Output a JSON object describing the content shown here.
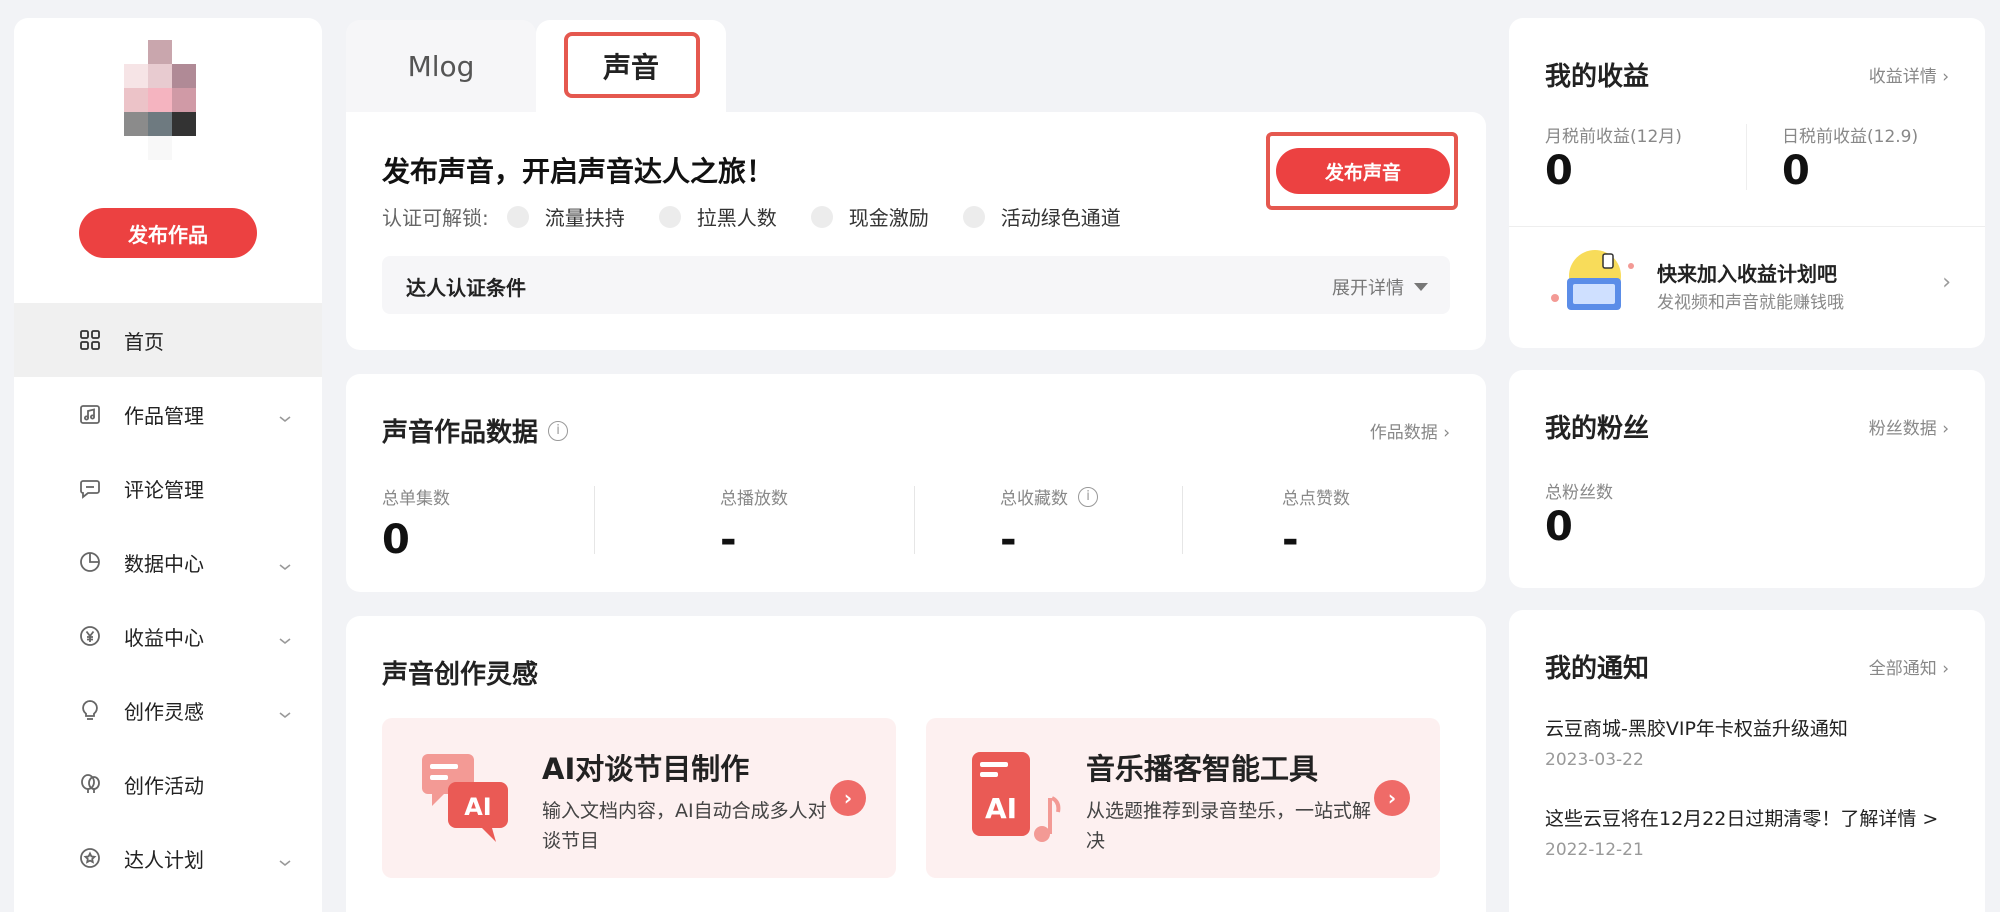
{
  "sidebar": {
    "publish_button": "发布作品",
    "items": [
      {
        "label": "首页",
        "icon": "grid-icon",
        "has_chevron": false,
        "active": true
      },
      {
        "label": "作品管理",
        "icon": "music-doc-icon",
        "has_chevron": true
      },
      {
        "label": "评论管理",
        "icon": "comment-icon",
        "has_chevron": false
      },
      {
        "label": "数据中心",
        "icon": "pie-chart-icon",
        "has_chevron": true
      },
      {
        "label": "收益中心",
        "icon": "yen-icon",
        "has_chevron": true
      },
      {
        "label": "创作灵感",
        "icon": "lightbulb-icon",
        "has_chevron": true
      },
      {
        "label": "创作活动",
        "icon": "balloon-icon",
        "has_chevron": false
      },
      {
        "label": "达人计划",
        "icon": "star-badge-icon",
        "has_chevron": true
      }
    ]
  },
  "tabs": [
    {
      "label": "Mlog"
    },
    {
      "label": "声音"
    }
  ],
  "publish": {
    "title": "发布声音，开启声音达人之旅！",
    "unlock_label": "认证可解锁:",
    "perks": [
      "流量扶持",
      "拉黑人数",
      "现金激励",
      "活动绿色通道"
    ],
    "publish_button": "发布声音",
    "conditions_label": "达人认证条件",
    "expand_label": "展开详情"
  },
  "stats": {
    "title": "声音作品数据",
    "link": "作品数据",
    "items": [
      {
        "label": "总单集数",
        "value": "0"
      },
      {
        "label": "总播放数",
        "value": "-"
      },
      {
        "label": "总收藏数",
        "value": "-"
      },
      {
        "label": "总点赞数",
        "value": "-"
      }
    ]
  },
  "inspiration": {
    "title": "声音创作灵感",
    "items": [
      {
        "title": "AI对谈节目制作",
        "desc": "输入文档内容，AI自动合成多人对谈节目",
        "art_label": "AI"
      },
      {
        "title": "音乐播客智能工具",
        "desc": "从选题推荐到录音垫乐，一站式解决",
        "art_label": "AI"
      }
    ]
  },
  "earnings": {
    "title": "我的收益",
    "link": "收益详情",
    "monthly_label": "月税前收益(12月)",
    "monthly_value": "0",
    "daily_label": "日税前收益(12.9)",
    "daily_value": "0",
    "plan_title": "快来加入收益计划吧",
    "plan_sub": "发视频和声音就能赚钱哦"
  },
  "fans": {
    "title": "我的粉丝",
    "link": "粉丝数据",
    "total_label": "总粉丝数",
    "total_value": "0"
  },
  "notices": {
    "title": "我的通知",
    "link": "全部通知",
    "items": [
      {
        "title": "云豆商城-黑胶VIP年卡权益升级通知",
        "date": "2023-03-22"
      },
      {
        "title": "这些云豆将在12月22日过期清零！了解详情 >",
        "date": "2022-12-21"
      }
    ]
  },
  "colors": {
    "accent": "#ec4141",
    "highlight_border": "#e5584f",
    "bg": "#f2f3f6"
  }
}
